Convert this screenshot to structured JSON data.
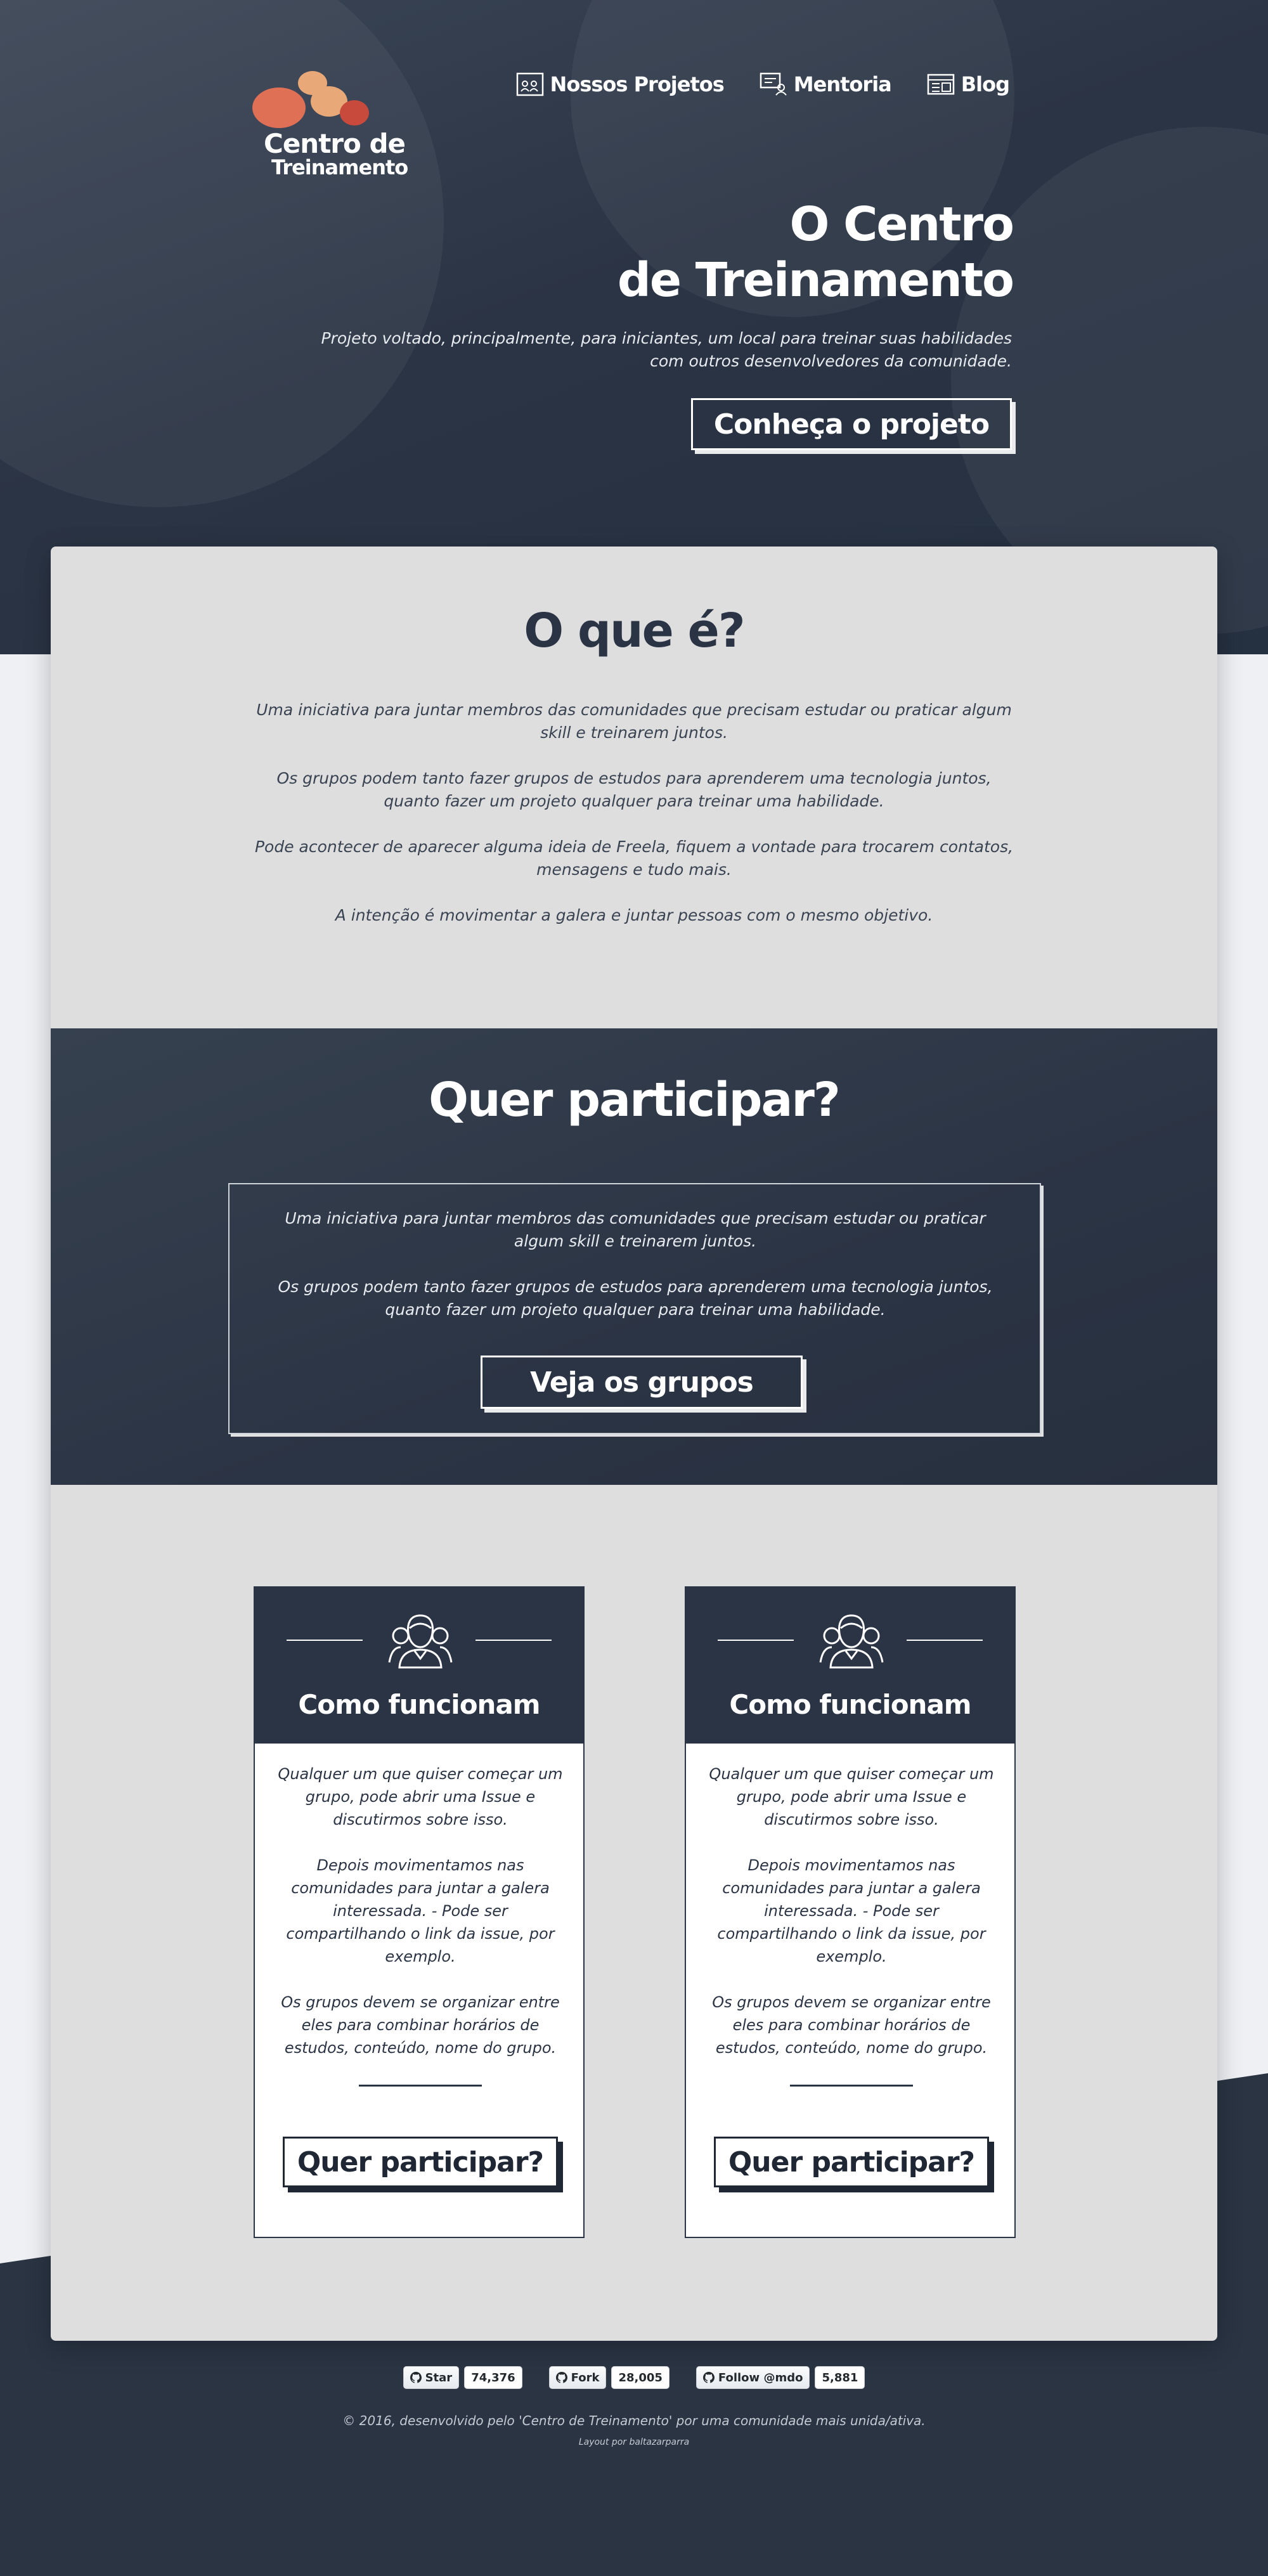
{
  "logo": {
    "line1": "Centro de",
    "line2": "Treinamento"
  },
  "nav": {
    "items": [
      {
        "label": "Nossos Projetos",
        "icon": "projects-icon"
      },
      {
        "label": "Mentoria",
        "icon": "mentoria-icon"
      },
      {
        "label": "Blog",
        "icon": "blog-icon"
      }
    ]
  },
  "hero": {
    "title_line1": "O Centro",
    "title_line2": "de Treinamento",
    "description_line1": "Projeto voltado, principalmente, para iniciantes, um local para treinar suas habilidades",
    "description_line2": "com outros desenvolvedores da comunidade.",
    "button": "Conheça o projeto"
  },
  "about": {
    "title": "O que é?",
    "paragraphs": [
      "Uma iniciativa para juntar membros das comunidades que precisam estudar ou praticar algum skill e treinarem juntos.",
      "Os grupos podem tanto fazer grupos de estudos para aprenderem uma tecnologia juntos, quanto fazer um projeto qualquer para treinar uma habilidade.",
      "Pode acontecer de aparecer alguma ideia de Freela, fiquem a vontade para trocarem contatos, mensagens e tudo mais.",
      "A intenção é movimentar a galera e juntar pessoas com o mesmo objetivo."
    ]
  },
  "participate": {
    "title": "Quer participar?",
    "paragraphs": [
      "Uma iniciativa para juntar membros das comunidades que precisam estudar ou praticar algum skill e treinarem juntos.",
      "Os grupos podem tanto fazer grupos de estudos para aprenderem uma tecnologia juntos, quanto fazer um projeto qualquer para treinar uma habilidade."
    ],
    "button": "Veja os grupos"
  },
  "cards": [
    {
      "title": "Como funcionam",
      "paragraphs": [
        "Qualquer um que quiser começar um grupo, pode abrir uma Issue e discutirmos sobre isso.",
        "Depois movimentamos nas comunidades para juntar a galera interessada. - Pode ser compartilhando o link da issue, por exemplo.",
        "Os grupos devem se organizar entre eles para combinar horários de estudos, conteúdo, nome do grupo."
      ],
      "button": "Quer participar?"
    },
    {
      "title": "Como funcionam",
      "paragraphs": [
        "Qualquer um que quiser começar um grupo, pode abrir uma Issue e discutirmos sobre isso.",
        "Depois movimentamos nas comunidades para juntar a galera interessada. - Pode ser compartilhando o link da issue, por exemplo.",
        "Os grupos devem se organizar entre eles para combinar horários de estudos, conteúdo, nome do grupo."
      ],
      "button": "Quer participar?"
    }
  ],
  "github": [
    {
      "label": "Star",
      "count": "74,376"
    },
    {
      "label": "Fork",
      "count": "28,005"
    },
    {
      "label": "Follow @mdo",
      "count": "5,881"
    }
  ],
  "footer": {
    "text": "© 2016, desenvolvido pelo 'Centro de Treinamento' por uma comunidade mais unida/ativa.",
    "credit": "Layout por baltazarparra"
  },
  "colors": {
    "dark": "#2b3444",
    "light_card": "#dedede",
    "logo_orange": "#e07055",
    "logo_peach": "#e8a878",
    "logo_red": "#c84a3c"
  }
}
